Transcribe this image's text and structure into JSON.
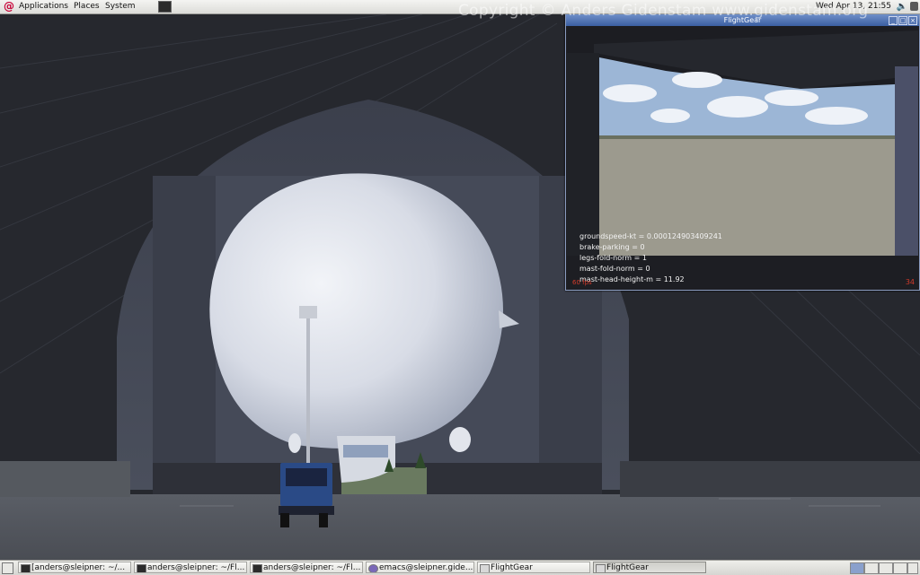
{
  "top_panel": {
    "menus": [
      "Applications",
      "Places",
      "System"
    ],
    "clock": "Wed Apr 13, 21:55",
    "volume_icon": "speaker-icon"
  },
  "watermark": "Copyright © Anders Gidenstam   www.gidenstam.org",
  "flightgear_window": {
    "title": "FlightGear",
    "hud_lines": [
      "groundspeed-kt = 0.000124903409241",
      "brake-parking = 0",
      "legs-fold-norm = 1",
      "mast-fold-norm = 0",
      "mast-head-height-m = 11.92"
    ],
    "fps_left": "60 fps",
    "fps_right": "34"
  },
  "taskbar": {
    "tasks": [
      "[anders@sleipner: ~/...",
      "anders@sleipner: ~/Fl...",
      "anders@sleipner: ~/Fl...",
      "emacs@sleipner.gide...",
      "FlightGear",
      "FlightGear"
    ]
  },
  "colors": {
    "hangar_dark": "#2b2e36",
    "sky": "#9cb6d6",
    "airship_body": "#dde0ea",
    "hud_text": "#f2f2f2",
    "fps_red": "#d23a2a"
  }
}
